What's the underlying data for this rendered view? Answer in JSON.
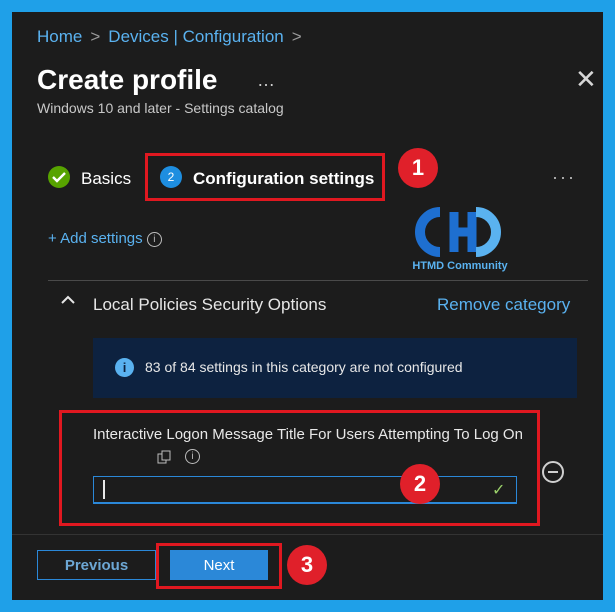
{
  "breadcrumb": {
    "home": "Home",
    "sep": ">",
    "devices": "Devices | Configuration"
  },
  "header": {
    "title": "Create profile",
    "more": "…",
    "subtitle": "Windows 10 and later - Settings catalog",
    "close": "✕"
  },
  "steps": [
    {
      "label": "Basics",
      "status": "complete"
    },
    {
      "number": "2",
      "label": "Configuration settings",
      "status": "current"
    }
  ],
  "steps_more": "···",
  "callouts": {
    "one": "1",
    "two": "2",
    "three": "3"
  },
  "logo": {
    "text": "HTMD Community"
  },
  "add_settings": {
    "label": "+ Add settings",
    "info": "i"
  },
  "category": {
    "label": "Local Policies Security Options",
    "remove": "Remove category"
  },
  "info_bar": {
    "icon": "i",
    "text": "83 of 84 settings in this category are not configured"
  },
  "setting": {
    "label": "Interactive Logon Message Title For Users Attempting To Log On",
    "value": "",
    "check": "✓"
  },
  "footer": {
    "previous": "Previous",
    "next": "Next"
  },
  "colors": {
    "frame": "#1fa0e8",
    "panel": "#1c1c1c",
    "link": "#5ab2f0",
    "primary_button": "#2b88d8",
    "highlight": "#e01820",
    "success": "#57a300"
  },
  "icons": [
    "chevron-right-icon",
    "more-icon",
    "close-icon",
    "checkmark-icon",
    "info-icon",
    "chevron-up-icon",
    "copy-icon",
    "remove-icon"
  ]
}
